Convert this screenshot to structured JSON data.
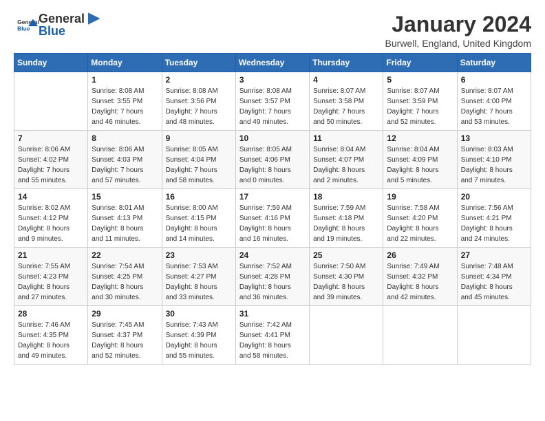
{
  "header": {
    "logo_general": "General",
    "logo_blue": "Blue",
    "title": "January 2024",
    "subtitle": "Burwell, England, United Kingdom"
  },
  "weekdays": [
    "Sunday",
    "Monday",
    "Tuesday",
    "Wednesday",
    "Thursday",
    "Friday",
    "Saturday"
  ],
  "weeks": [
    [
      {
        "day": "",
        "info": ""
      },
      {
        "day": "1",
        "info": "Sunrise: 8:08 AM\nSunset: 3:55 PM\nDaylight: 7 hours\nand 46 minutes."
      },
      {
        "day": "2",
        "info": "Sunrise: 8:08 AM\nSunset: 3:56 PM\nDaylight: 7 hours\nand 48 minutes."
      },
      {
        "day": "3",
        "info": "Sunrise: 8:08 AM\nSunset: 3:57 PM\nDaylight: 7 hours\nand 49 minutes."
      },
      {
        "day": "4",
        "info": "Sunrise: 8:07 AM\nSunset: 3:58 PM\nDaylight: 7 hours\nand 50 minutes."
      },
      {
        "day": "5",
        "info": "Sunrise: 8:07 AM\nSunset: 3:59 PM\nDaylight: 7 hours\nand 52 minutes."
      },
      {
        "day": "6",
        "info": "Sunrise: 8:07 AM\nSunset: 4:00 PM\nDaylight: 7 hours\nand 53 minutes."
      }
    ],
    [
      {
        "day": "7",
        "info": "Sunrise: 8:06 AM\nSunset: 4:02 PM\nDaylight: 7 hours\nand 55 minutes."
      },
      {
        "day": "8",
        "info": "Sunrise: 8:06 AM\nSunset: 4:03 PM\nDaylight: 7 hours\nand 57 minutes."
      },
      {
        "day": "9",
        "info": "Sunrise: 8:05 AM\nSunset: 4:04 PM\nDaylight: 7 hours\nand 58 minutes."
      },
      {
        "day": "10",
        "info": "Sunrise: 8:05 AM\nSunset: 4:06 PM\nDaylight: 8 hours\nand 0 minutes."
      },
      {
        "day": "11",
        "info": "Sunrise: 8:04 AM\nSunset: 4:07 PM\nDaylight: 8 hours\nand 2 minutes."
      },
      {
        "day": "12",
        "info": "Sunrise: 8:04 AM\nSunset: 4:09 PM\nDaylight: 8 hours\nand 5 minutes."
      },
      {
        "day": "13",
        "info": "Sunrise: 8:03 AM\nSunset: 4:10 PM\nDaylight: 8 hours\nand 7 minutes."
      }
    ],
    [
      {
        "day": "14",
        "info": "Sunrise: 8:02 AM\nSunset: 4:12 PM\nDaylight: 8 hours\nand 9 minutes."
      },
      {
        "day": "15",
        "info": "Sunrise: 8:01 AM\nSunset: 4:13 PM\nDaylight: 8 hours\nand 11 minutes."
      },
      {
        "day": "16",
        "info": "Sunrise: 8:00 AM\nSunset: 4:15 PM\nDaylight: 8 hours\nand 14 minutes."
      },
      {
        "day": "17",
        "info": "Sunrise: 7:59 AM\nSunset: 4:16 PM\nDaylight: 8 hours\nand 16 minutes."
      },
      {
        "day": "18",
        "info": "Sunrise: 7:59 AM\nSunset: 4:18 PM\nDaylight: 8 hours\nand 19 minutes."
      },
      {
        "day": "19",
        "info": "Sunrise: 7:58 AM\nSunset: 4:20 PM\nDaylight: 8 hours\nand 22 minutes."
      },
      {
        "day": "20",
        "info": "Sunrise: 7:56 AM\nSunset: 4:21 PM\nDaylight: 8 hours\nand 24 minutes."
      }
    ],
    [
      {
        "day": "21",
        "info": "Sunrise: 7:55 AM\nSunset: 4:23 PM\nDaylight: 8 hours\nand 27 minutes."
      },
      {
        "day": "22",
        "info": "Sunrise: 7:54 AM\nSunset: 4:25 PM\nDaylight: 8 hours\nand 30 minutes."
      },
      {
        "day": "23",
        "info": "Sunrise: 7:53 AM\nSunset: 4:27 PM\nDaylight: 8 hours\nand 33 minutes."
      },
      {
        "day": "24",
        "info": "Sunrise: 7:52 AM\nSunset: 4:28 PM\nDaylight: 8 hours\nand 36 minutes."
      },
      {
        "day": "25",
        "info": "Sunrise: 7:50 AM\nSunset: 4:30 PM\nDaylight: 8 hours\nand 39 minutes."
      },
      {
        "day": "26",
        "info": "Sunrise: 7:49 AM\nSunset: 4:32 PM\nDaylight: 8 hours\nand 42 minutes."
      },
      {
        "day": "27",
        "info": "Sunrise: 7:48 AM\nSunset: 4:34 PM\nDaylight: 8 hours\nand 45 minutes."
      }
    ],
    [
      {
        "day": "28",
        "info": "Sunrise: 7:46 AM\nSunset: 4:35 PM\nDaylight: 8 hours\nand 49 minutes."
      },
      {
        "day": "29",
        "info": "Sunrise: 7:45 AM\nSunset: 4:37 PM\nDaylight: 8 hours\nand 52 minutes."
      },
      {
        "day": "30",
        "info": "Sunrise: 7:43 AM\nSunset: 4:39 PM\nDaylight: 8 hours\nand 55 minutes."
      },
      {
        "day": "31",
        "info": "Sunrise: 7:42 AM\nSunset: 4:41 PM\nDaylight: 8 hours\nand 58 minutes."
      },
      {
        "day": "",
        "info": ""
      },
      {
        "day": "",
        "info": ""
      },
      {
        "day": "",
        "info": ""
      }
    ]
  ]
}
